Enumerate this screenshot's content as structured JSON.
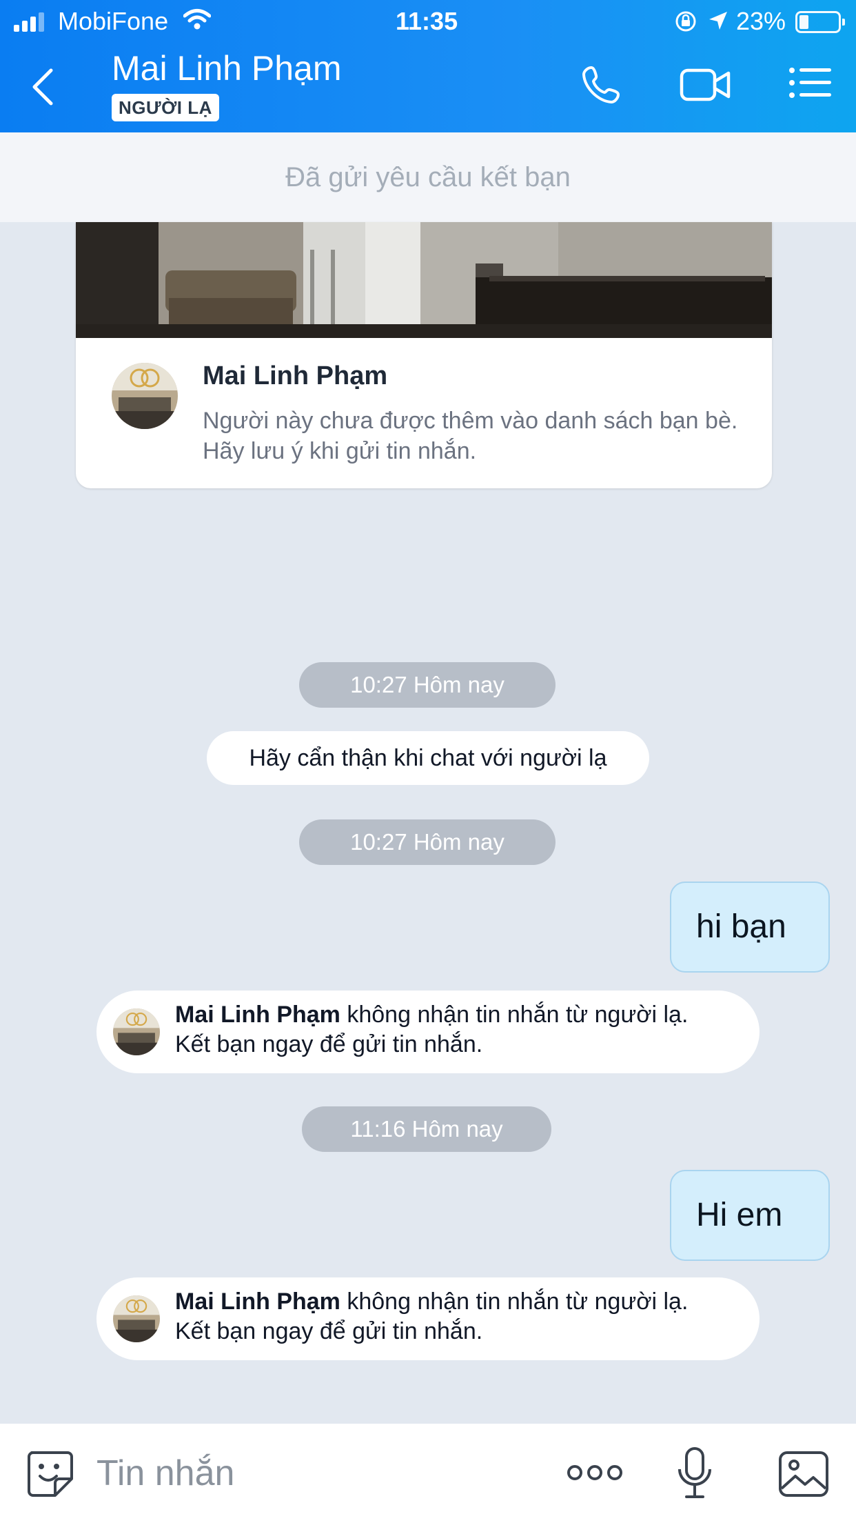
{
  "status_bar": {
    "carrier": "MobiFone",
    "time": "11:35",
    "battery": "23%"
  },
  "header": {
    "title": "Mai Linh Phạm",
    "badge": "NGƯỜI LẠ"
  },
  "banner": {
    "text": "Đã gửi yêu cầu kết bạn"
  },
  "profile_card": {
    "name": "Mai Linh Phạm",
    "description": "Người này chưa được thêm vào danh sách bạn bè. Hãy lưu ý khi gửi tin nhắn."
  },
  "messages": {
    "ts1": "10:27 Hôm nay",
    "system_warning": "Hãy cẩn thận khi chat với người lạ",
    "ts2": "10:27 Hôm nay",
    "out1": "hi bạn",
    "notice1": {
      "name": "Mai Linh Phạm",
      "line1_rest": " không nhận tin nhắn từ người lạ.",
      "line2": "Kết bạn ngay để gửi tin nhắn."
    },
    "ts3": "11:16 Hôm nay",
    "out2": "Hi em",
    "notice2": {
      "name": "Mai Linh Phạm",
      "line1_rest": " không nhận tin nhắn từ người lạ.",
      "line2": "Kết bạn ngay để gửi tin nhắn."
    }
  },
  "composer": {
    "placeholder": "Tin nhắn"
  },
  "colors": {
    "header": "#0a7df2",
    "background": "#e2e8f0",
    "outgoing_bubble": "#d4eefc",
    "timestamp_pill": "#b7bec8"
  }
}
